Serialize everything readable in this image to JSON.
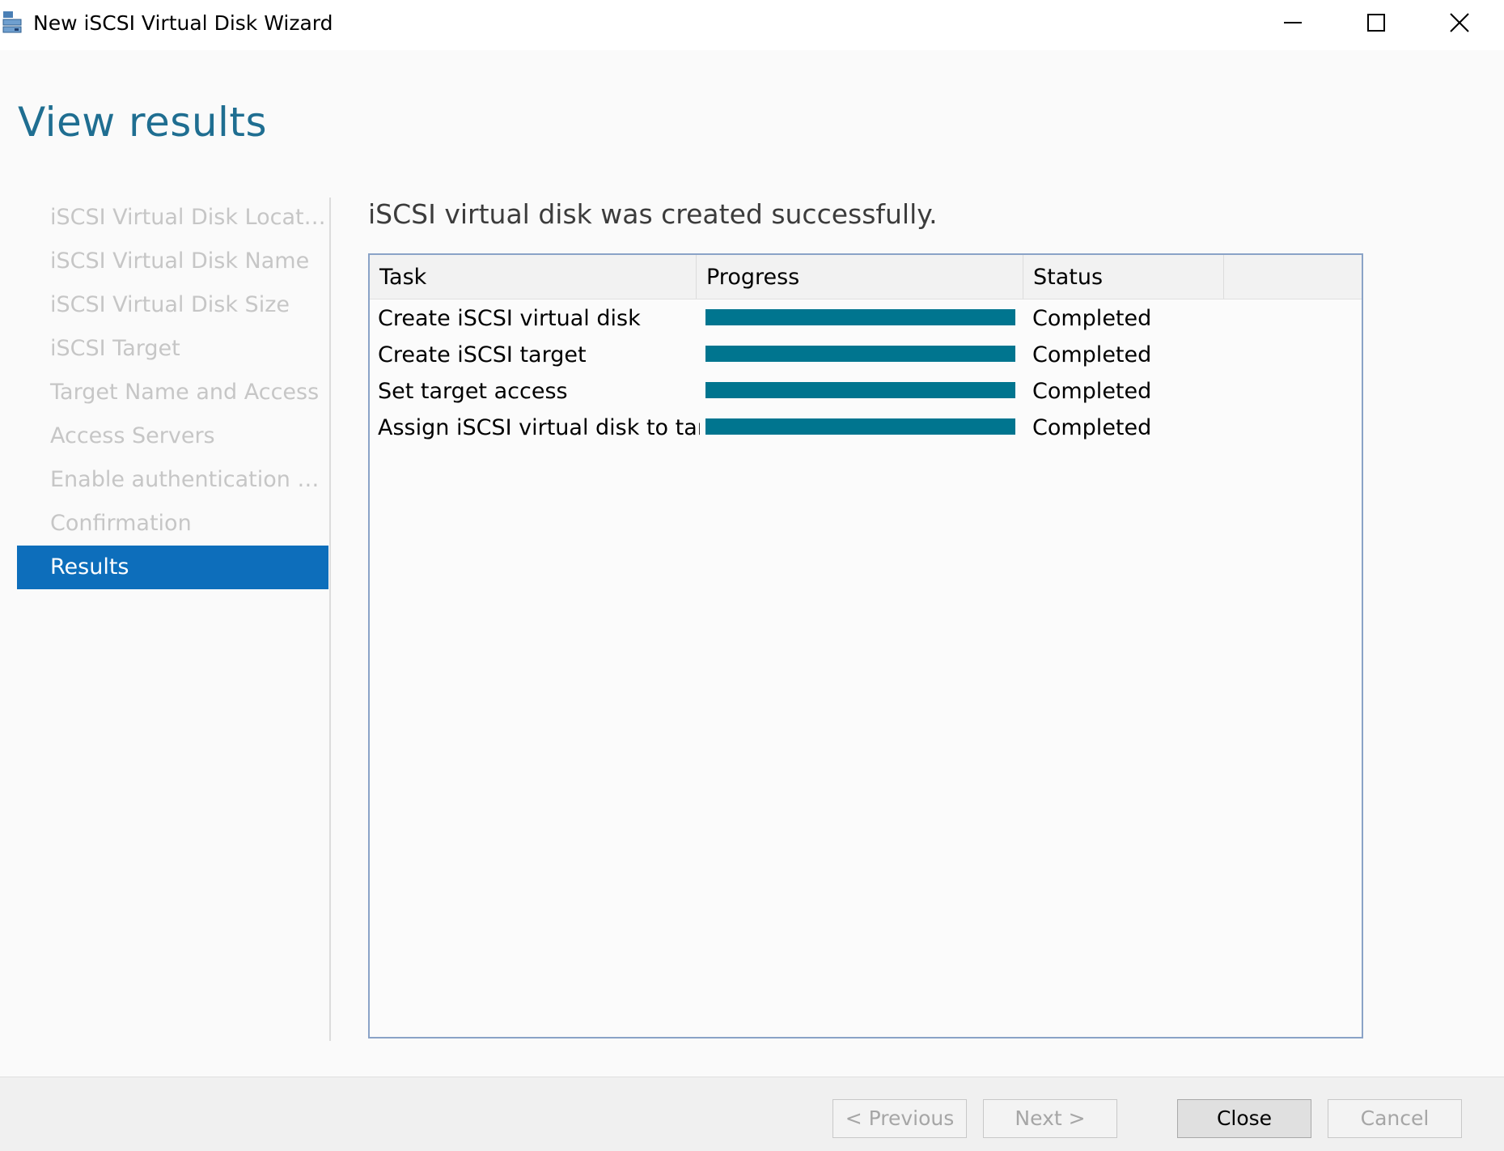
{
  "window": {
    "title": "New iSCSI Virtual Disk Wizard",
    "app_icon": "iscsi-disk-icon",
    "controls": {
      "minimize_icon": "minimize-icon",
      "maximize_icon": "maximize-icon",
      "close_icon": "close-icon"
    }
  },
  "page": {
    "title": "View results"
  },
  "nav": {
    "items": [
      {
        "label": "iSCSI Virtual Disk Location",
        "state": "disabled"
      },
      {
        "label": "iSCSI Virtual Disk Name",
        "state": "disabled"
      },
      {
        "label": "iSCSI Virtual Disk Size",
        "state": "disabled"
      },
      {
        "label": "iSCSI Target",
        "state": "disabled"
      },
      {
        "label": "Target Name and Access",
        "state": "disabled"
      },
      {
        "label": "Access Servers",
        "state": "disabled"
      },
      {
        "label": "Enable authentication ser...",
        "state": "disabled"
      },
      {
        "label": "Confirmation",
        "state": "disabled"
      },
      {
        "label": "Results",
        "state": "active"
      }
    ]
  },
  "main": {
    "message": "iSCSI virtual disk was created successfully.",
    "table": {
      "columns": [
        "Task",
        "Progress",
        "Status"
      ],
      "rows": [
        {
          "task": "Create iSCSI virtual disk",
          "progress_percent": 100,
          "status": "Completed"
        },
        {
          "task": "Create iSCSI target",
          "progress_percent": 100,
          "status": "Completed"
        },
        {
          "task": "Set target access",
          "progress_percent": 100,
          "status": "Completed"
        },
        {
          "task": "Assign iSCSI virtual disk to target",
          "progress_percent": 100,
          "status": "Completed"
        }
      ]
    }
  },
  "footer": {
    "previous_label": "< Previous",
    "next_label": "Next >",
    "close_label": "Close",
    "cancel_label": "Cancel"
  },
  "colors": {
    "accent": "#0d6ebb",
    "title_text": "#1f6e91",
    "progress_fill": "#00758f",
    "disabled_text": "#c6c6c6"
  }
}
